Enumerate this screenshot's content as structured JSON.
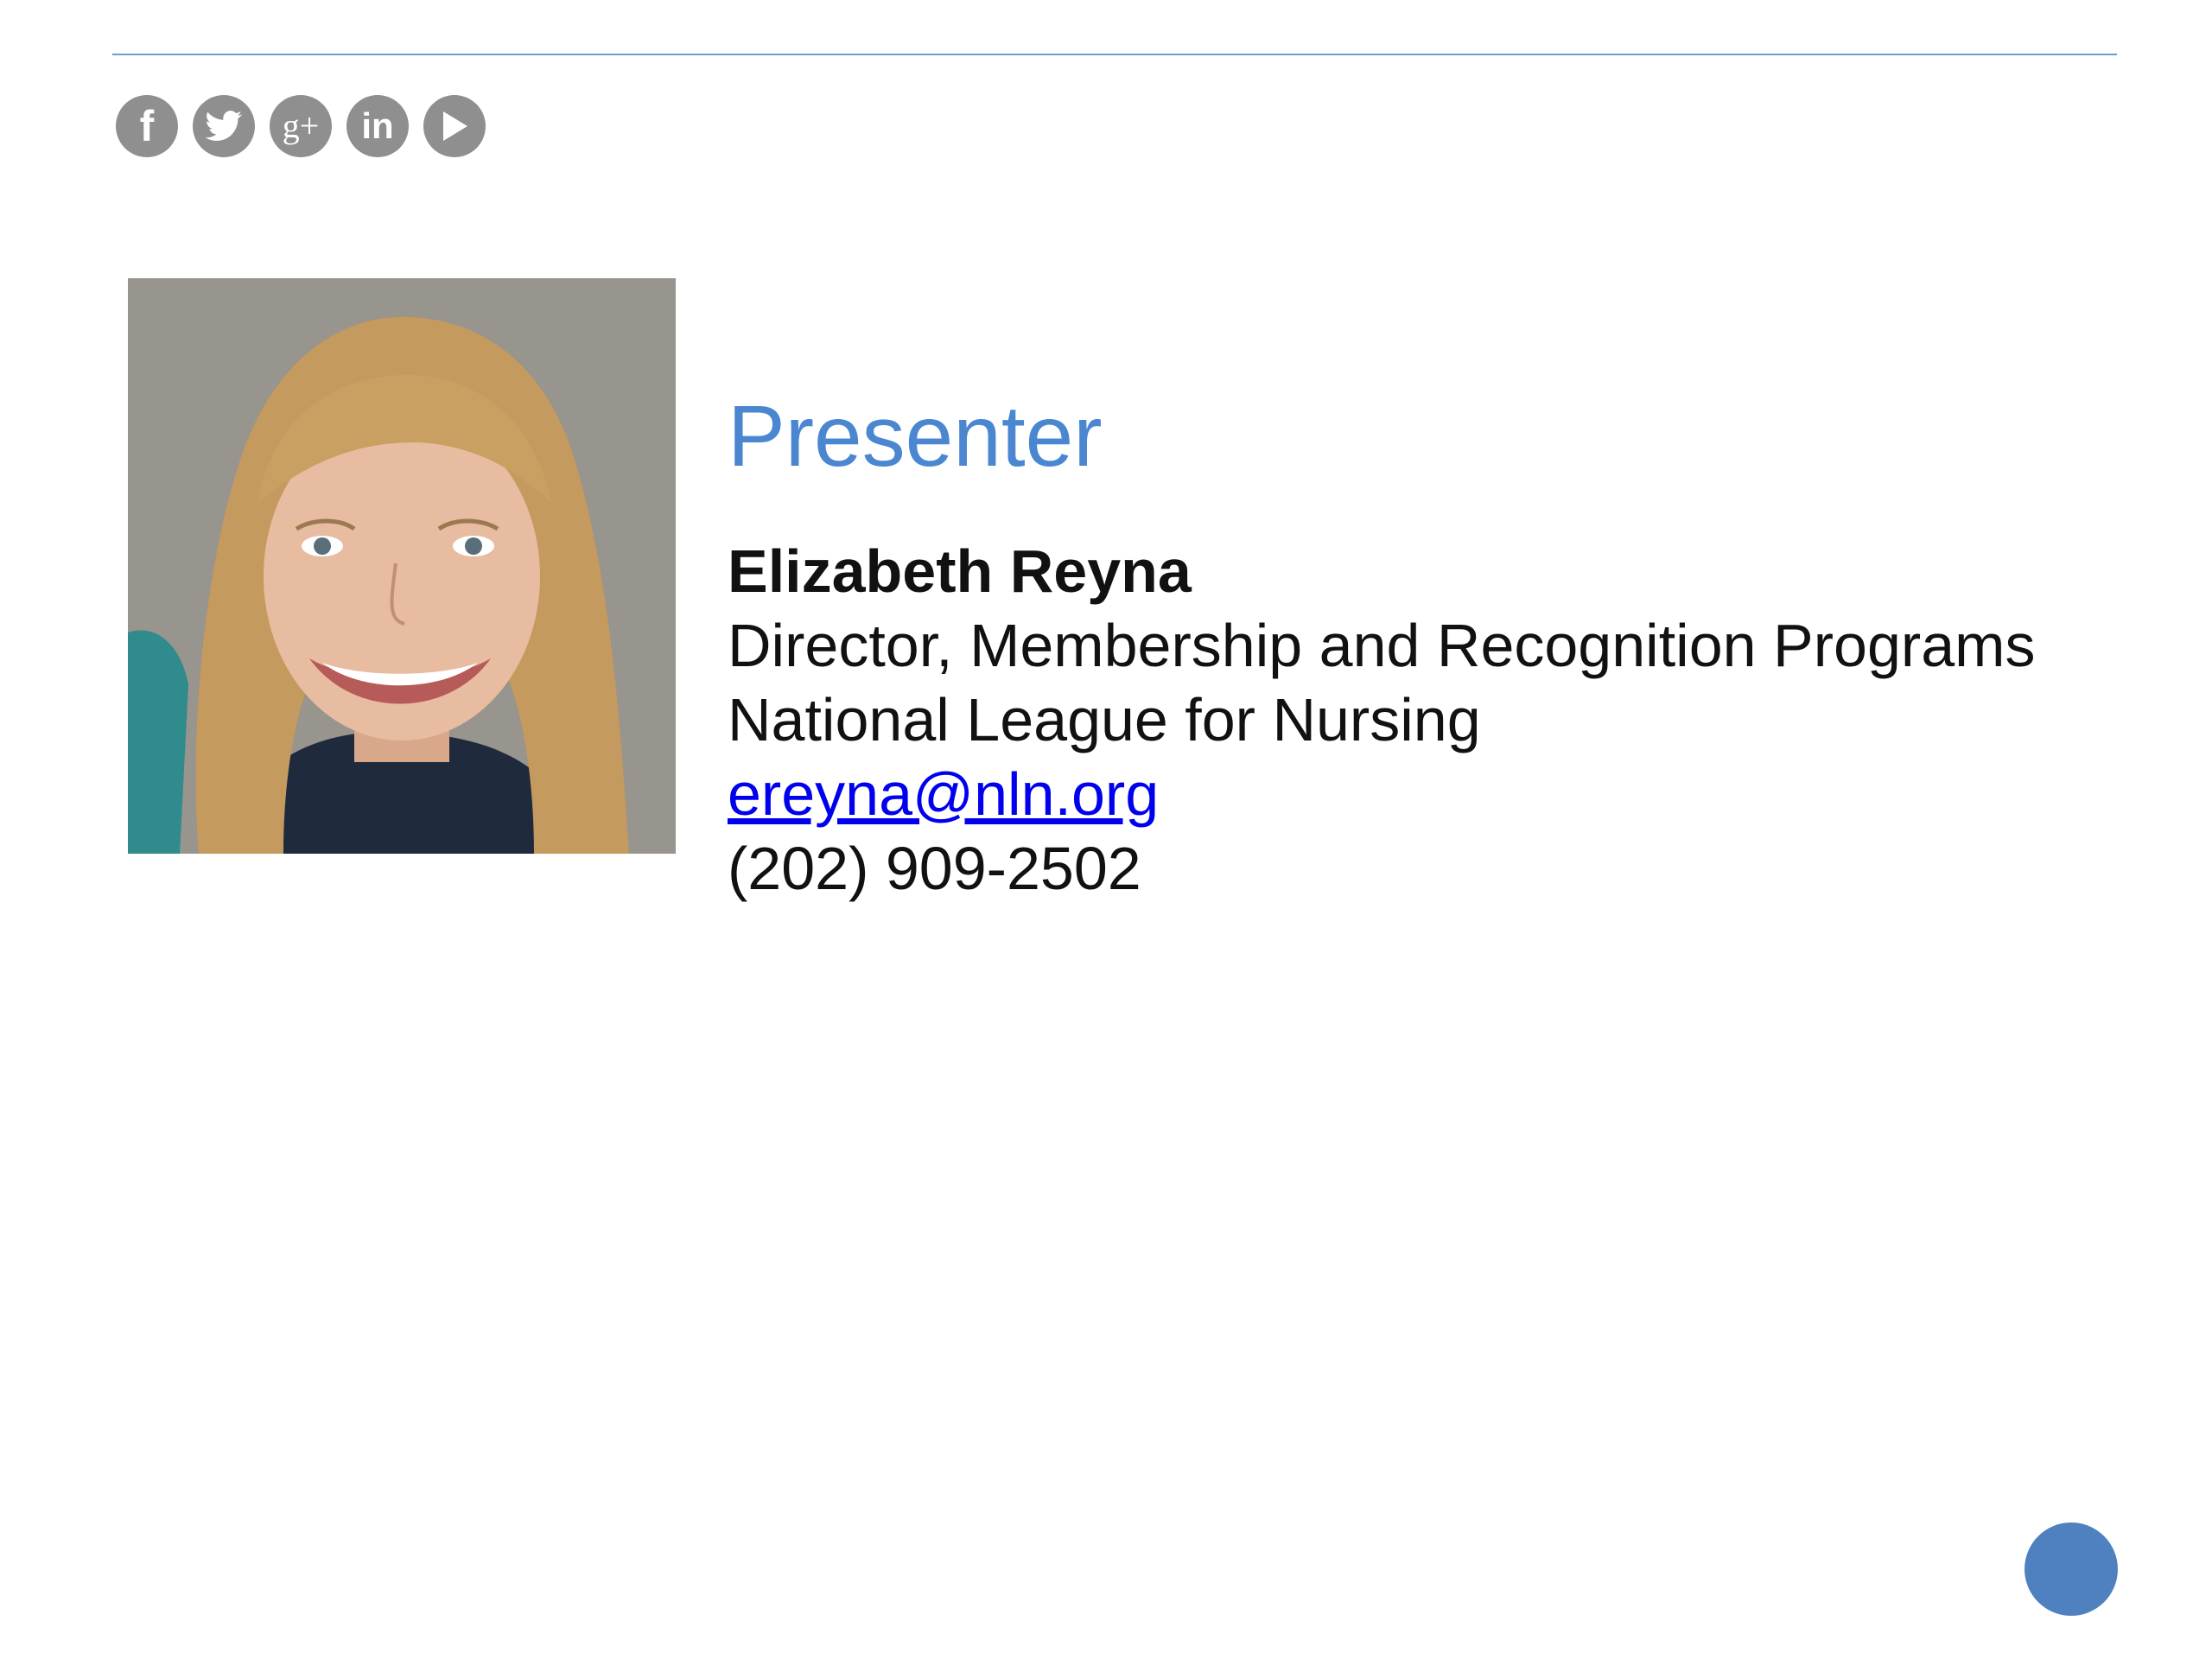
{
  "slide": {
    "heading": "Presenter",
    "accent_color": "#4a87d0",
    "rule_color": "#6f9bd1"
  },
  "social": {
    "icons": [
      {
        "name": "facebook-icon",
        "glyph": "f"
      },
      {
        "name": "twitter-icon",
        "glyph": ""
      },
      {
        "name": "google-plus-icon",
        "glyph": "g+"
      },
      {
        "name": "linkedin-icon",
        "glyph": "in"
      },
      {
        "name": "youtube-play-icon",
        "glyph": ""
      }
    ],
    "icon_color": "#8f8f8f"
  },
  "presenter": {
    "name": "Elizabeth Reyna",
    "title": "Director, Membership and Recognition Programs",
    "organization": "National League for Nursing",
    "email": "ereyna@nln.org",
    "phone": "(202) 909-2502"
  },
  "nav": {
    "dot_color": "#4f81c1"
  }
}
